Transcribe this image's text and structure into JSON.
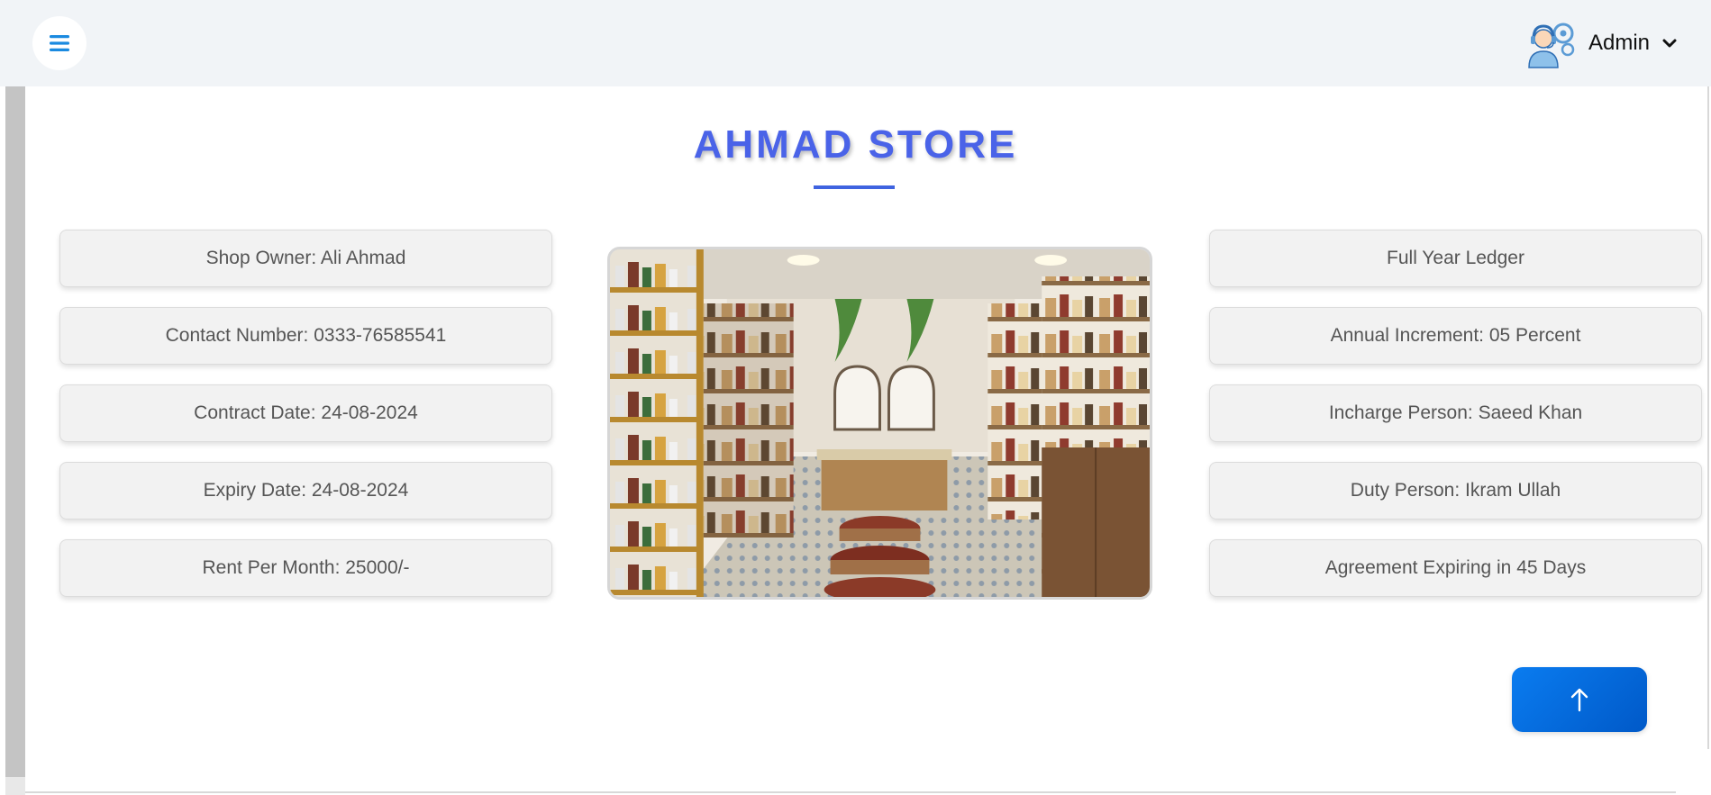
{
  "header": {
    "menu_icon": "hamburger-icon",
    "user": {
      "name": "Admin",
      "avatar_icon": "support-agent-avatar",
      "dropdown_icon": "chevron-down-icon"
    }
  },
  "store": {
    "title": "AHMAD STORE",
    "image": "store-interior-photo",
    "left_cards": [
      {
        "label": "Shop Owner: Ali Ahmad"
      },
      {
        "label": "Contact Number: 0333-76585541"
      },
      {
        "label": "Contract Date: 24-08-2024"
      },
      {
        "label": "Expiry Date: 24-08-2024"
      },
      {
        "label": "Rent Per Month: 25000/-"
      }
    ],
    "right_cards": [
      {
        "label": "Full Year Ledger"
      },
      {
        "label": "Annual Increment: 05 Percent"
      },
      {
        "label": "Incharge Person: Saeed Khan"
      },
      {
        "label": "Duty Person: Ikram Ullah"
      },
      {
        "label": "Agreement Expiring in 45 Days"
      }
    ]
  },
  "back_to_top": {
    "icon": "arrow-up-icon"
  },
  "colors": {
    "accent": "#4a63e8",
    "header_bg": "#f1f4f7",
    "button_blue": "#0a6fe6",
    "card_bg": "#f2f2f2"
  }
}
